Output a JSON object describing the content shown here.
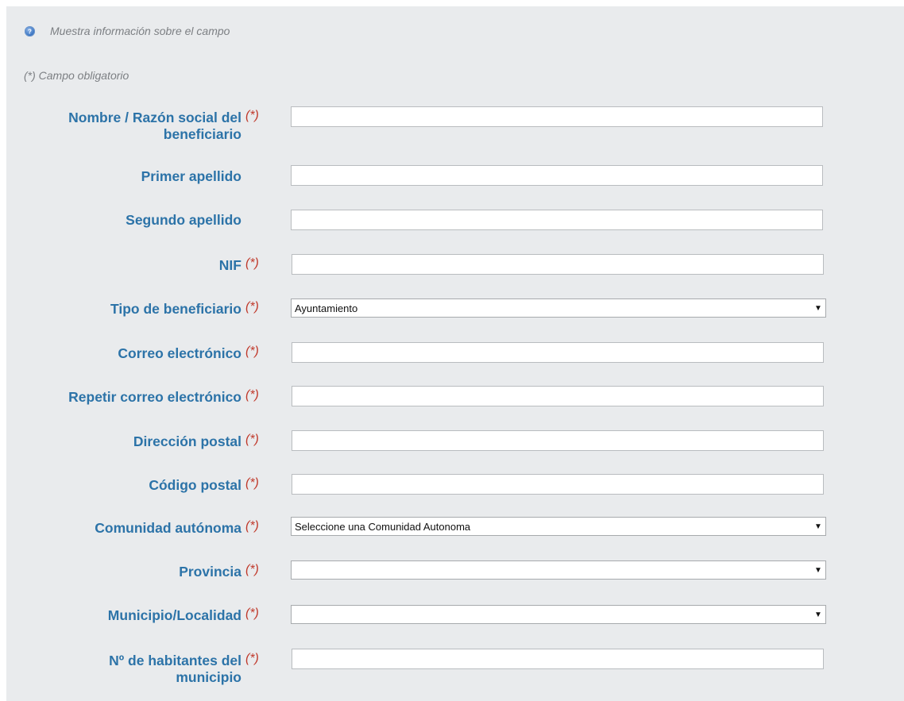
{
  "info": {
    "text": "Muestra información sobre el campo",
    "icon": "help-info-icon"
  },
  "required_note": "(*) Campo obligatorio",
  "required_marker": "(*)",
  "fields": [
    {
      "label_line1": "Nombre / Razón social del",
      "label_line2": "beneficiario",
      "required": true,
      "type": "text",
      "value": ""
    },
    {
      "label": "Primer apellido",
      "required": false,
      "type": "text",
      "value": ""
    },
    {
      "label": "Segundo apellido",
      "required": false,
      "type": "text",
      "value": ""
    },
    {
      "label": "NIF",
      "required": true,
      "type": "text",
      "value": ""
    },
    {
      "label": "Tipo de beneficiario",
      "required": true,
      "type": "select",
      "value": "Ayuntamiento"
    },
    {
      "label": "Correo electrónico",
      "required": true,
      "type": "text",
      "value": ""
    },
    {
      "label": "Repetir correo electrónico",
      "required": true,
      "type": "text",
      "value": ""
    },
    {
      "label": "Dirección postal",
      "required": true,
      "type": "text",
      "value": ""
    },
    {
      "label": "Código postal",
      "required": true,
      "type": "text",
      "value": ""
    },
    {
      "label": "Comunidad autónoma",
      "required": true,
      "type": "select",
      "value": "Seleccione una Comunidad Autonoma"
    },
    {
      "label": "Provincia",
      "required": true,
      "type": "select",
      "value": ""
    },
    {
      "label": "Municipio/Localidad",
      "required": true,
      "type": "select",
      "value": ""
    },
    {
      "label_line1": "Nº de habitantes del",
      "label_line2": "municipio",
      "required": true,
      "type": "text",
      "value": ""
    }
  ],
  "colors": {
    "label": "#2c73a8",
    "required": "#c0392b",
    "panel": "#e9ebed"
  }
}
